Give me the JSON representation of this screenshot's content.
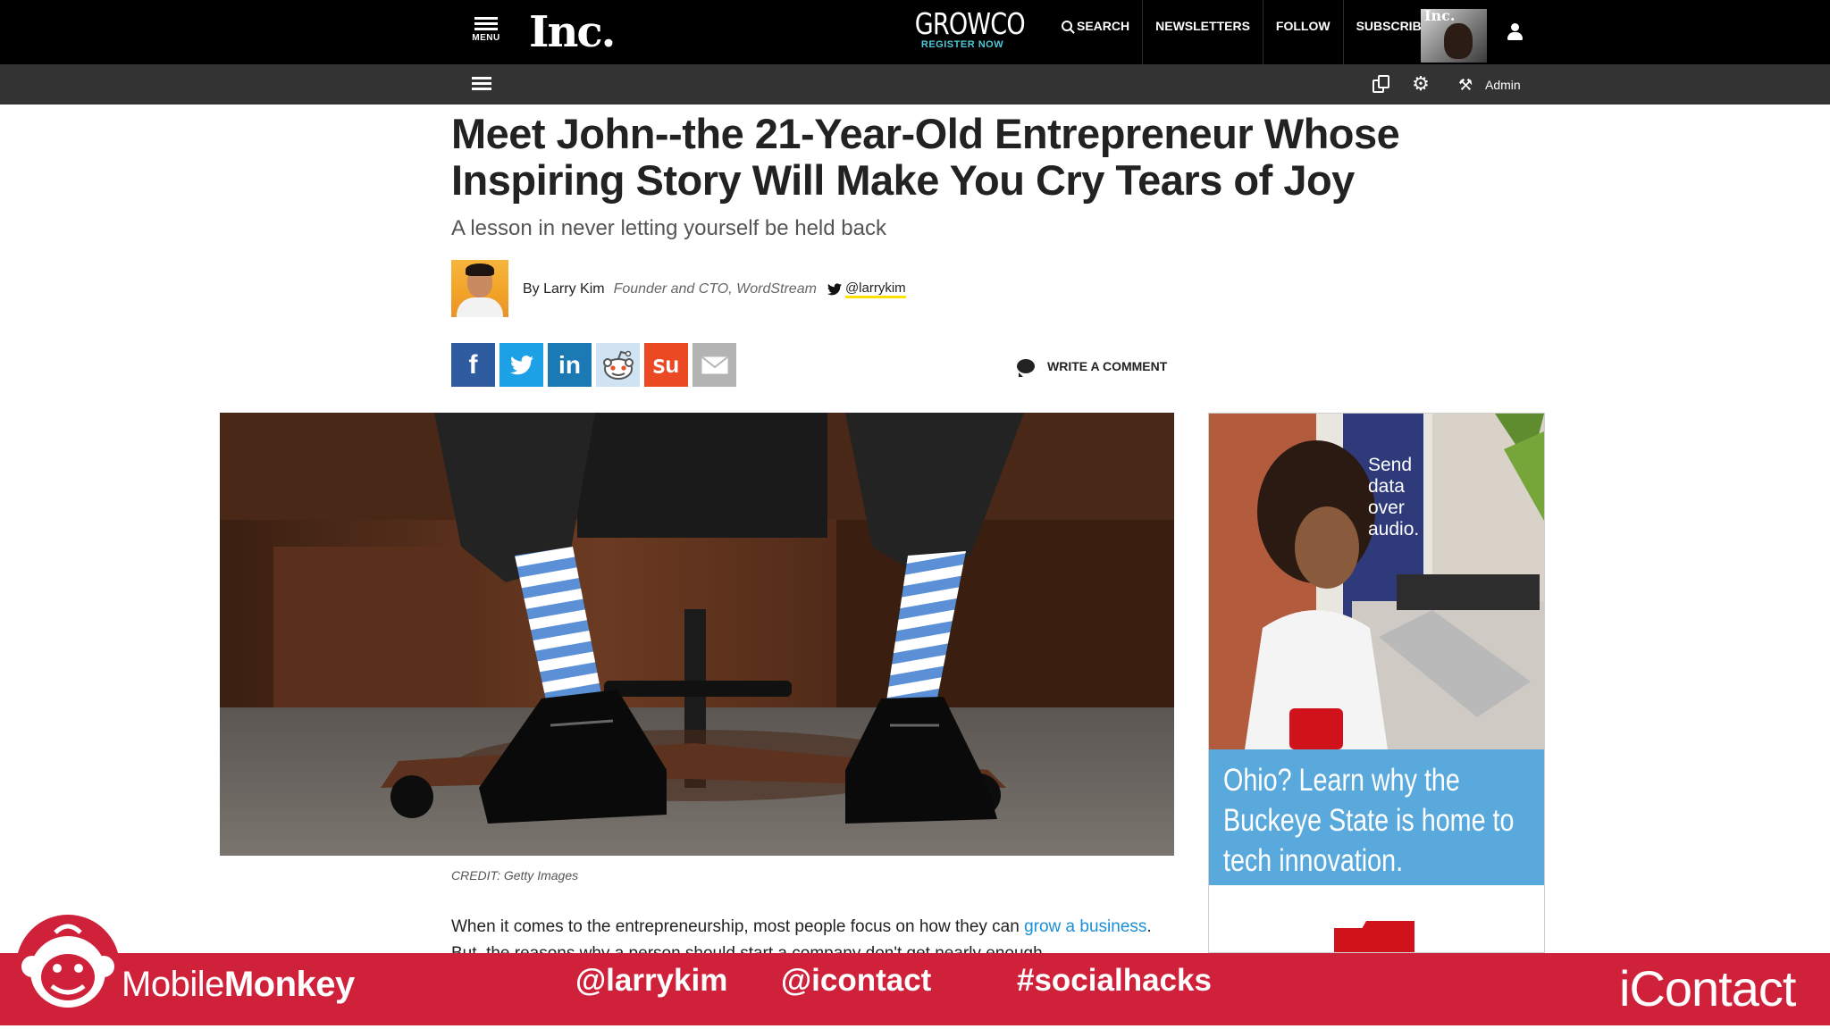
{
  "topnav": {
    "menu_label": "MENU",
    "logo": "Inc.",
    "growco": {
      "name": "GROWCO",
      "cta": "REGISTER NOW"
    },
    "links": [
      "SEARCH",
      "NEWSLETTERS",
      "FOLLOW",
      "SUBSCRIBE"
    ],
    "magazine_badge": "Inc."
  },
  "adminbar": {
    "admin_label": "Admin",
    "icons": [
      "list-icon",
      "copy-icon",
      "gear-icon",
      "tools-icon"
    ]
  },
  "article": {
    "headline": "Meet John--the 21-Year-Old Entrepreneur Whose Inspiring Story Will Make You Cry Tears of Joy",
    "dek": "A lesson in never letting yourself be held back",
    "author": {
      "by": "By Larry Kim",
      "role": "Founder and CTO, WordStream",
      "handle": "@larrykim"
    },
    "share_buttons": [
      "facebook",
      "twitter",
      "linkedin",
      "reddit",
      "stumbleupon",
      "email"
    ],
    "write_comment": "WRITE A COMMENT",
    "image_credit": "CREDIT: Getty Images",
    "body_start": "When it comes to the entrepreneurship, most people focus on how they can ",
    "body_link": "grow a business",
    "body_rest": ". But, the reasons why a person should start a company don't get nearly enough"
  },
  "ad": {
    "overlay": "Send data over audio.",
    "headline": "Ohio? Learn why the Buckeye State is home to tech innovation."
  },
  "footer": {
    "brand_left_1": "Mobile",
    "brand_left_2": "Monkey",
    "tags": [
      "@larrykim",
      "@icontact",
      "#socialhacks"
    ],
    "brand_right": "iContact",
    "color": "#d0213a"
  }
}
